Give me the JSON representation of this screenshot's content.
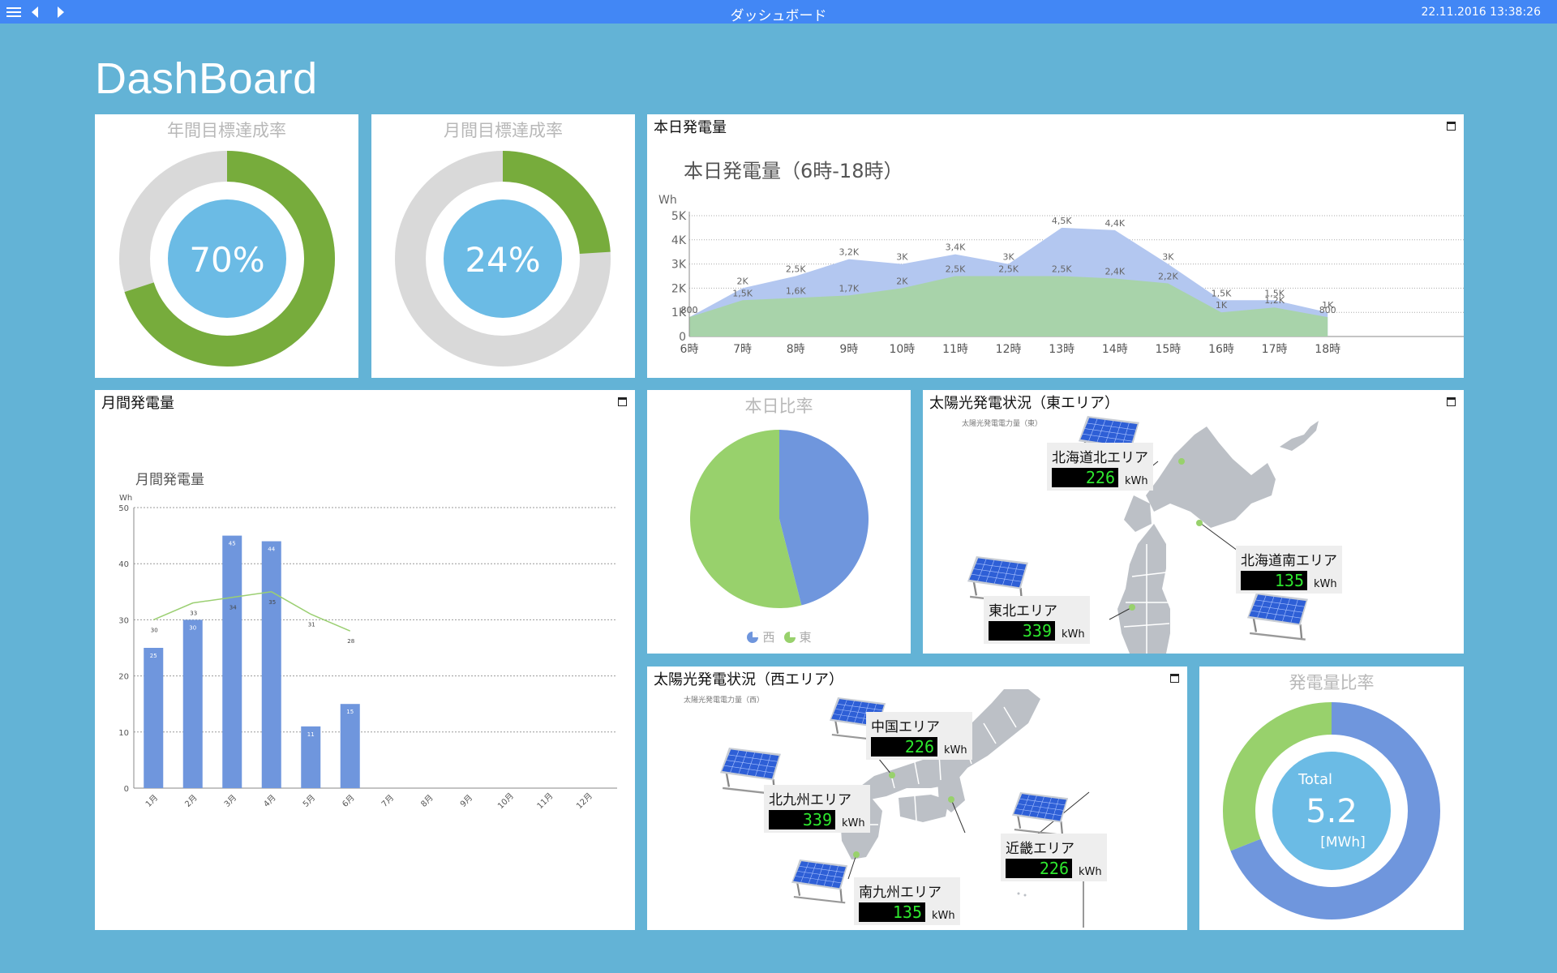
{
  "topbar": {
    "title": "ダッシュボード",
    "datetime": "22.11.2016 13:38:26",
    "icons": [
      "menu-icon",
      "back-arrow-icon",
      "forward-arrow-icon"
    ]
  },
  "page": {
    "title": "DashBoard"
  },
  "annual_target": {
    "title": "年間目標達成率",
    "value_label": "70%",
    "fraction": 0.7,
    "colors": {
      "fill": "#77ac3c",
      "track": "#d9d9d9",
      "center": "#6bbbe5"
    }
  },
  "monthly_target": {
    "title": "月間目標達成率",
    "value_label": "24%",
    "fraction": 0.24,
    "colors": {
      "fill": "#77ac3c",
      "track": "#d9d9d9",
      "center": "#6bbbe5"
    }
  },
  "today_generation": {
    "panel_title": "本日発電量",
    "chart_title": "本日発電量（6時-18時）",
    "chart_data": {
      "type": "area",
      "title": "本日発電量（6時-18時）",
      "ylabel": "Wh",
      "ylim": [
        0,
        5000
      ],
      "y_ticks": [
        "0",
        "1K",
        "2K",
        "3K",
        "4K",
        "5K"
      ],
      "categories": [
        "6時",
        "7時",
        "8時",
        "9時",
        "10時",
        "11時",
        "12時",
        "13時",
        "14時",
        "15時",
        "16時",
        "17時",
        "18時"
      ],
      "series": [
        {
          "color": "#b3c7f0",
          "values": [
            800,
            2000,
            2500,
            3200,
            3000,
            3400,
            3000,
            4500,
            4400,
            3000,
            1500,
            1500,
            1000
          ],
          "labels": [
            "800",
            "2K",
            "2,5K",
            "3,2K",
            "3K",
            "3,4K",
            "3K",
            "4,5K",
            "4,4K",
            "3K",
            "1,5K",
            "1,5K",
            "1K"
          ]
        },
        {
          "color": "#a8d4a5",
          "values": [
            800,
            1500,
            1600,
            1700,
            2000,
            2500,
            2500,
            2500,
            2400,
            2200,
            1000,
            1200,
            800
          ],
          "labels": [
            "800",
            "1,5K",
            "1,6K",
            "1,7K",
            "2K",
            "2,5K",
            "2,5K",
            "2,5K",
            "2,4K",
            "2,2K",
            "1K",
            "1,2K",
            "800"
          ]
        }
      ],
      "grid": true
    }
  },
  "monthly_generation": {
    "panel_title": "月間発電量",
    "chart_title": "月間発電量",
    "chart_data": {
      "type": "bar",
      "title": "月間発電量",
      "ylabel": "Wh",
      "ylim": [
        0,
        50
      ],
      "y_ticks": [
        "0",
        "10",
        "20",
        "30",
        "40",
        "50"
      ],
      "categories": [
        "1月",
        "2月",
        "3月",
        "4月",
        "5月",
        "6月",
        "7月",
        "8月",
        "9月",
        "10月",
        "11月",
        "12月"
      ],
      "bar_values": [
        25,
        30,
        45,
        44,
        11,
        15
      ],
      "bar_labels": [
        "25",
        "30",
        "45",
        "44",
        "11",
        "15"
      ],
      "line_values": [
        30,
        33,
        34,
        35,
        31,
        28
      ],
      "line_labels": [
        "30",
        "33",
        "34",
        "35",
        "31",
        "28"
      ],
      "colors": {
        "bar": "#6f96dd",
        "line": "#9bcf72"
      },
      "grid": true
    }
  },
  "today_ratio": {
    "title": "本日比率",
    "chart_data": {
      "type": "pie",
      "labels": [
        "西",
        "東"
      ],
      "values": [
        46,
        54
      ],
      "colors": [
        "#6f96dd",
        "#98d16c"
      ]
    }
  },
  "east_status": {
    "panel_title": "太陽光発電状況（東エリア）",
    "map_caption": "太陽光発電電力量（東）",
    "areas": [
      {
        "name": "北海道北エリア",
        "value": "226",
        "unit": "kWh"
      },
      {
        "name": "北海道南エリア",
        "value": "135",
        "unit": "kWh"
      },
      {
        "name": "東北エリア",
        "value": "339",
        "unit": "kWh"
      }
    ]
  },
  "west_status": {
    "panel_title": "太陽光発電状況（西エリア）",
    "map_caption": "太陽光発電電力量（西）",
    "areas": [
      {
        "name": "中国エリア",
        "value": "226",
        "unit": "kWh"
      },
      {
        "name": "北九州エリア",
        "value": "339",
        "unit": "kWh"
      },
      {
        "name": "近畿エリア",
        "value": "226",
        "unit": "kWh"
      },
      {
        "name": "南九州エリア",
        "value": "135",
        "unit": "kWh"
      }
    ]
  },
  "generation_ratio": {
    "title": "発電量比率",
    "total_label": "Total",
    "total_value": "5.2",
    "total_unit": "[MWh]",
    "chart_data": {
      "type": "pie",
      "values": [
        0.69,
        0.31
      ],
      "colors": [
        "#6f96dd",
        "#98d16c"
      ]
    },
    "center_color": "#6bbbe5"
  }
}
